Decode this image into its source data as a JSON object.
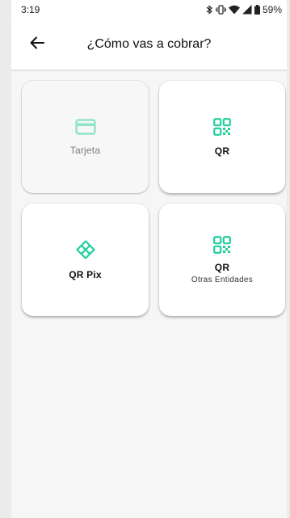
{
  "status_bar": {
    "time": "3:19",
    "battery": "59%",
    "icons": [
      "bluetooth-icon",
      "vibrate-icon",
      "wifi-icon",
      "cell-signal-icon",
      "battery-icon"
    ]
  },
  "header": {
    "title": "¿Cómo vas a cobrar?",
    "back_icon": "arrow-left-icon"
  },
  "colors": {
    "accent": "#1fcf9e",
    "accent_disabled": "#8fe3c9",
    "card_background": "#ffffff",
    "screen_background": "#f6f6f6"
  },
  "payment_options": [
    {
      "label": "Tarjeta",
      "icon": "credit-card-icon",
      "enabled": false
    },
    {
      "label": "QR",
      "icon": "qr-code-icon",
      "enabled": true
    },
    {
      "label": "QR Pix",
      "icon": "pix-icon",
      "enabled": true
    },
    {
      "label": "QR",
      "sublabel": "Otras Entidades",
      "icon": "qr-code-icon",
      "enabled": true
    }
  ]
}
